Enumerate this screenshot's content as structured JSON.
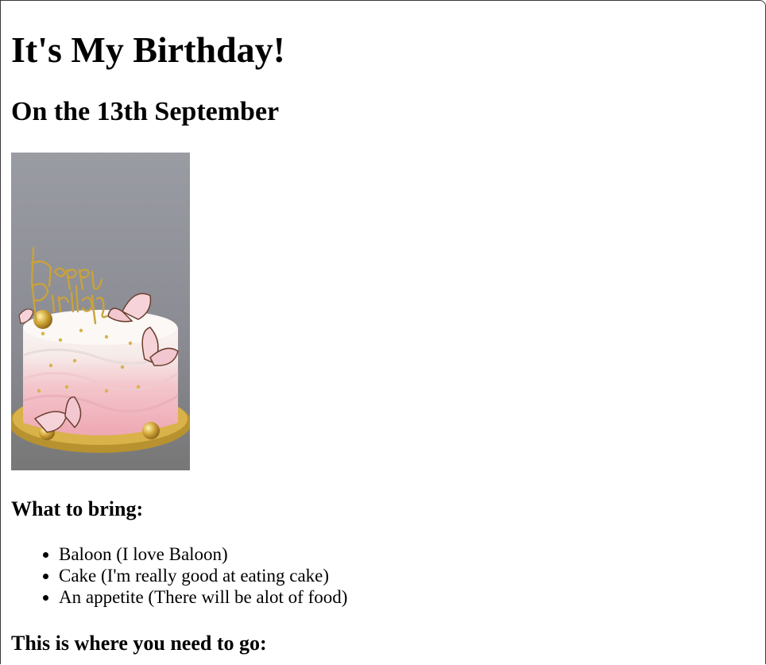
{
  "page": {
    "heading": "It's My Birthday!",
    "subheading": "On the 13th September",
    "image": {
      "icon": "birthday-cake-image",
      "topper_text_line1": "Happy",
      "topper_text_line2": "Birthday"
    },
    "bring_heading": "What to bring:",
    "bring_items": [
      "Baloon (I love Baloon)",
      "Cake (I'm really good at eating cake)",
      "An appetite (There will be alot of food)"
    ],
    "go_heading": "This is where you need to go:"
  },
  "colors": {
    "text": "#000000",
    "background": "#ffffff",
    "cake_pink": "#f0b8c0",
    "cake_white": "#f7f3f0",
    "gold": "#c9a23a",
    "photo_backdrop": "#8e8f96"
  }
}
